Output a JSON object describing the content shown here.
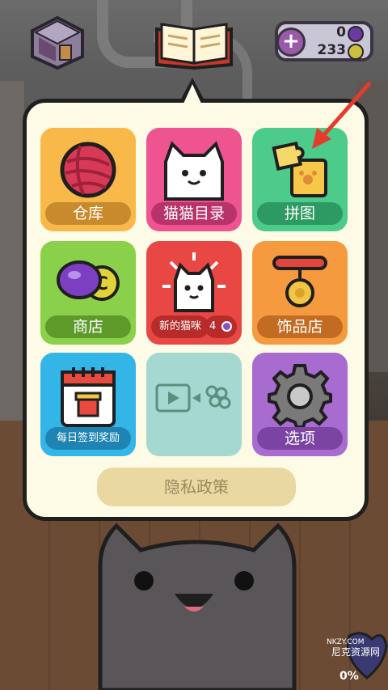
{
  "currency": {
    "gems": "0",
    "coins": "233"
  },
  "menu": {
    "tiles": [
      {
        "label": "仓库"
      },
      {
        "label": "猫猫目录"
      },
      {
        "label": "拼图"
      },
      {
        "label": "商店"
      },
      {
        "label": "新的猫咪",
        "badge": "4"
      },
      {
        "label": "饰品店"
      },
      {
        "label": "每日签到奖励"
      },
      {
        "label": ""
      },
      {
        "label": "选项"
      }
    ],
    "privacy": "隐私政策"
  },
  "watermark": {
    "text_top": "NKZY.COM",
    "text_bottom": "尼克资源网"
  },
  "progress_text": "0%",
  "icons": [
    "home-icon",
    "book-icon",
    "plus-icon",
    "gem-icon",
    "coin-icon",
    "yarn-icon",
    "cat-catalog-icon",
    "puzzle-icon",
    "shop-icon",
    "new-cat-icon",
    "charm-icon",
    "calendar-icon",
    "ad-video-icon",
    "settings-gear-icon"
  ],
  "colors": {
    "panel": "#fdfbe6",
    "accent_arrow": "#e53b2c"
  }
}
